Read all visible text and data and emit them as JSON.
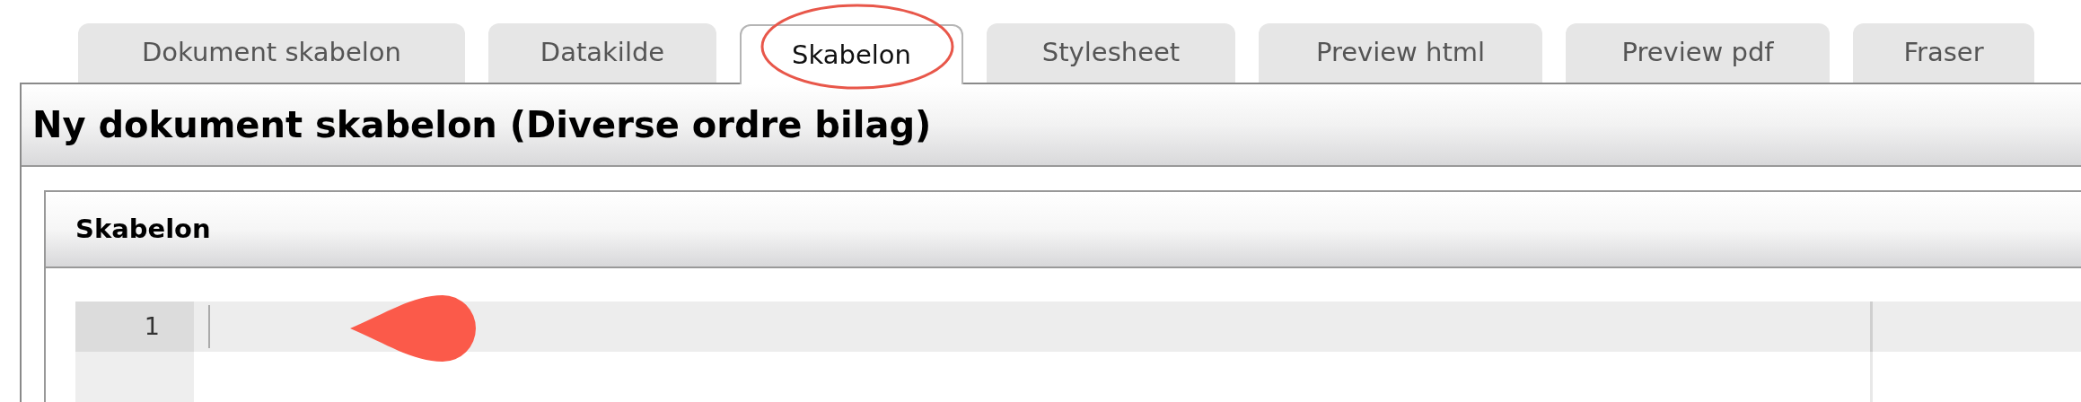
{
  "tabs": [
    {
      "label": "Dokument skabelon",
      "selected": false
    },
    {
      "label": "Datakilde",
      "selected": false
    },
    {
      "label": "Skabelon",
      "selected": true
    },
    {
      "label": "Stylesheet",
      "selected": false
    },
    {
      "label": "Preview html",
      "selected": false
    },
    {
      "label": "Preview pdf",
      "selected": false
    },
    {
      "label": "Fraser",
      "selected": false
    }
  ],
  "title": "Ny dokument skabelon (Diverse ordre bilag)",
  "panel": {
    "title": "Skabelon",
    "editor": {
      "line_numbers": [
        "1"
      ]
    }
  }
}
